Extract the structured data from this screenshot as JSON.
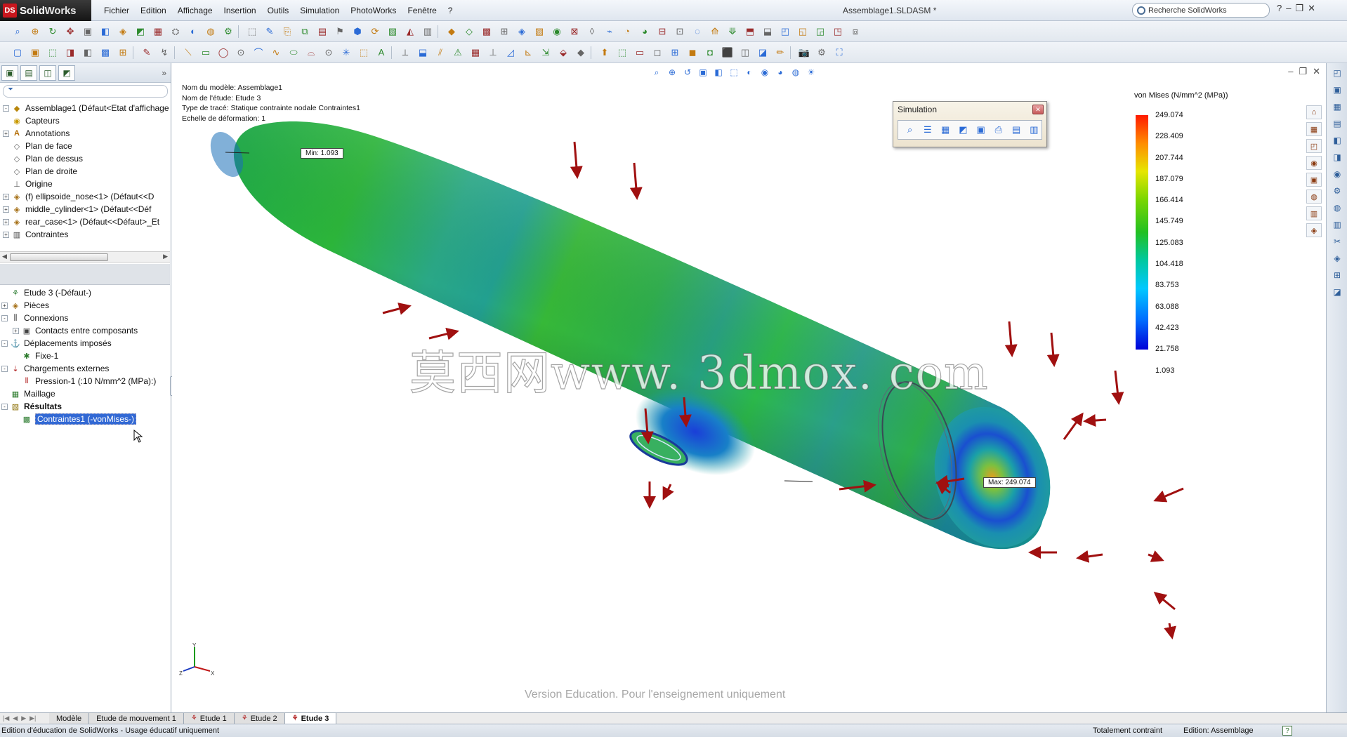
{
  "app": {
    "logo_brand": "Solid",
    "logo_brand2": "Works",
    "logo_mark": "DS",
    "document_title": "Assemblage1.SLDASM *",
    "search_placeholder": "Recherche SolidWorks",
    "window_controls": [
      "?",
      "–",
      "❐",
      "✕"
    ]
  },
  "menus": [
    "Fichier",
    "Edition",
    "Affichage",
    "Insertion",
    "Outils",
    "Simulation",
    "PhotoWorks",
    "Fenêtre",
    "?"
  ],
  "feature_tree": {
    "filter_icon": "filter-icon",
    "items": [
      {
        "label": "Assemblage1  (Défaut<Etat d'affichage",
        "icon": "assembly-icon",
        "expand": "-"
      },
      {
        "label": "Capteurs",
        "icon": "sensors-icon",
        "expand": ""
      },
      {
        "label": "Annotations",
        "icon": "annotations-icon",
        "expand": "+"
      },
      {
        "label": "Plan de face",
        "icon": "plane-icon",
        "expand": ""
      },
      {
        "label": "Plan de dessus",
        "icon": "plane-icon",
        "expand": ""
      },
      {
        "label": "Plan de droite",
        "icon": "plane-icon",
        "expand": ""
      },
      {
        "label": "Origine",
        "icon": "origin-icon",
        "expand": ""
      },
      {
        "label": "(f) ellipsoide_nose<1> (Défaut<<D",
        "icon": "part-icon",
        "expand": "+"
      },
      {
        "label": "middle_cylinder<1> (Défaut<<Déf",
        "icon": "part-icon",
        "expand": "+"
      },
      {
        "label": "rear_case<1> (Défaut<<Défaut>_Et",
        "icon": "part-icon",
        "expand": "+"
      },
      {
        "label": "Contraintes",
        "icon": "mates-icon",
        "expand": "+"
      }
    ]
  },
  "study_tree": {
    "items": [
      {
        "label": "Etude 3 (-Défaut-)",
        "indent": 0,
        "expand": "",
        "icon": "study-icon"
      },
      {
        "label": "Pièces",
        "indent": 0,
        "expand": "+",
        "icon": "parts-icon"
      },
      {
        "label": "Connexions",
        "indent": 0,
        "expand": "-",
        "icon": "connections-icon"
      },
      {
        "label": "Contacts entre composants",
        "indent": 1,
        "expand": "+",
        "icon": "contacts-icon"
      },
      {
        "label": "Déplacements imposés",
        "indent": 0,
        "expand": "-",
        "icon": "fixtures-icon"
      },
      {
        "label": "Fixe-1",
        "indent": 1,
        "expand": "",
        "icon": "fixed-icon"
      },
      {
        "label": "Chargements externes",
        "indent": 0,
        "expand": "-",
        "icon": "loads-icon"
      },
      {
        "label": "Pression-1 (:10 N/mm^2 (MPa):)",
        "indent": 1,
        "expand": "",
        "icon": "pressure-icon"
      },
      {
        "label": "Maillage",
        "indent": 0,
        "expand": "",
        "icon": "mesh-icon"
      },
      {
        "label": "Résultats",
        "indent": 0,
        "expand": "-",
        "icon": "results-icon",
        "bold": true
      },
      {
        "label": "Contraintes1 (-vonMises-)",
        "indent": 1,
        "expand": "",
        "icon": "stress-plot-icon",
        "selected": true
      }
    ]
  },
  "graphics": {
    "info_lines": [
      "Nom du modèle: Assemblage1",
      "Nom de l'étude: Etude 3",
      "Type de tracé: Statique contrainte nodale Contraintes1",
      "Echelle de déformation: 1"
    ],
    "min_label": "Min: 1.093",
    "max_label": "Max: 249.074",
    "watermark": "莫西网www. 3dmox. com",
    "education_notice": "Version Education. Pour l'enseignement uniquement",
    "triad_axes": [
      "Y",
      "Z",
      "X"
    ]
  },
  "simulation_toolbar": {
    "title": "Simulation",
    "buttons": [
      "zoom-icon",
      "list-icon",
      "plot-icon",
      "results-icon",
      "export-icon",
      "print-icon",
      "settings-icon",
      "probe-icon"
    ]
  },
  "legend": {
    "title": "von Mises (N/mm^2 (MPa))",
    "values": [
      "249.074",
      "228.409",
      "207.744",
      "187.079",
      "166.414",
      "145.749",
      "125.083",
      "104.418",
      "83.753",
      "63.088",
      "42.423",
      "21.758",
      "1.093"
    ]
  },
  "bottom_tabs": [
    {
      "label": "Modèle",
      "active": false,
      "sim": false
    },
    {
      "label": "Etude de mouvement 1",
      "active": false,
      "sim": false
    },
    {
      "label": "Etude 1",
      "active": false,
      "sim": true
    },
    {
      "label": "Etude 2",
      "active": false,
      "sim": true
    },
    {
      "label": "Etude 3",
      "active": true,
      "sim": true
    }
  ],
  "status_bar": {
    "left_text": "Edition d'éducation de SolidWorks - Usage éducatif uniquement",
    "constraint_status": "Totalement contraint",
    "edit_mode": "Edition: Assemblage",
    "help_icon": "?"
  },
  "colors": {
    "stress_max": "#ff1a00",
    "stress_mid": "#22c022",
    "stress_min": "#0000d8",
    "selection": "#3168d4",
    "load_arrow": "#a01010"
  }
}
